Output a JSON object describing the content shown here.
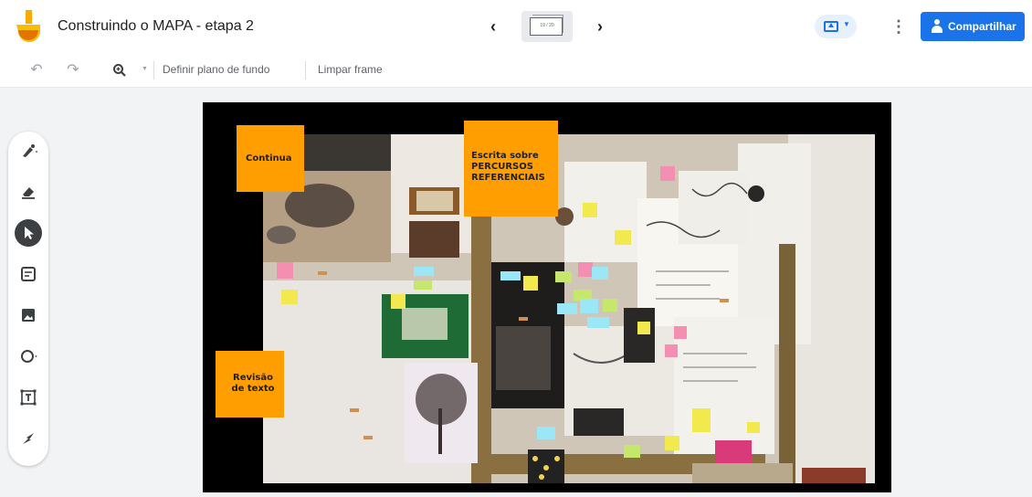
{
  "header": {
    "title": "Construindo o MAPA - etapa 2",
    "frame_counter": "19 / 20",
    "share_label": "Compartilhar"
  },
  "toolbar": {
    "background_label": "Definir plano de fundo",
    "clear_label": "Limpar frame"
  },
  "board": {
    "notes": [
      {
        "text": "Continua"
      },
      {
        "text": "Escrita sobre PERCURSOS REFERENCIAIS"
      },
      {
        "text": "Revisão de texto"
      }
    ]
  },
  "icons": {
    "logo": "jamboard-logo-icon",
    "prev": "chevron-left-icon",
    "next": "chevron-right-icon",
    "cast": "present-screen-icon",
    "more": "more-vert-icon",
    "undo": "undo-icon",
    "redo": "redo-icon",
    "zoom": "zoom-icon",
    "tools": [
      "pen-icon",
      "eraser-icon",
      "select-arrow-icon",
      "sticky-note-icon",
      "image-icon",
      "circle-shape-icon",
      "text-box-icon",
      "laser-icon"
    ]
  },
  "colors": {
    "accent": "#1a73e8",
    "sticky": "#ff9e00",
    "active_tool": "#3c4043"
  }
}
